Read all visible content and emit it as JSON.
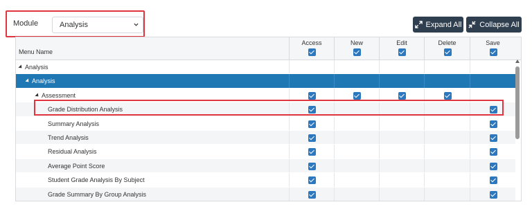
{
  "filter": {
    "module_label": "Module",
    "module_value": "Analysis"
  },
  "toolbar": {
    "expand_label": "Expand All",
    "collapse_label": "Collapse All"
  },
  "grid": {
    "menu_name_header": "Menu Name",
    "columns": [
      "Access",
      "New",
      "Edit",
      "Delete",
      "Save"
    ],
    "rows": [
      {
        "name": "Analysis",
        "level": 0,
        "expandable": true,
        "checks": [
          false,
          false,
          false,
          false,
          false
        ]
      },
      {
        "name": "Analysis",
        "level": 1,
        "expandable": true,
        "selected": true,
        "checks": [
          false,
          false,
          false,
          false,
          false
        ]
      },
      {
        "name": "Assessment",
        "level": 2,
        "expandable": true,
        "checks": [
          true,
          true,
          true,
          true,
          false
        ]
      },
      {
        "name": "Grade Distribution Analysis",
        "level": 3,
        "checks": [
          true,
          false,
          false,
          false,
          true
        ]
      },
      {
        "name": "Summary Analysis",
        "level": 3,
        "checks": [
          true,
          false,
          false,
          false,
          true
        ]
      },
      {
        "name": "Trend Analysis",
        "level": 3,
        "checks": [
          true,
          false,
          false,
          false,
          true
        ]
      },
      {
        "name": "Residual Analysis",
        "level": 3,
        "checks": [
          true,
          false,
          false,
          false,
          true
        ]
      },
      {
        "name": "Average Point Score",
        "level": 3,
        "checks": [
          true,
          false,
          false,
          false,
          true
        ]
      },
      {
        "name": "Student Grade Analysis By Subject",
        "level": 3,
        "checks": [
          true,
          false,
          false,
          false,
          true
        ]
      },
      {
        "name": "Grade Summary By Group Analysis",
        "level": 3,
        "checks": [
          true,
          false,
          false,
          false,
          true
        ]
      }
    ]
  },
  "colors": {
    "accent": "#2c78bf",
    "selected_row": "#1f77b4",
    "highlight": "#e0343f",
    "button": "#2f3f50"
  }
}
